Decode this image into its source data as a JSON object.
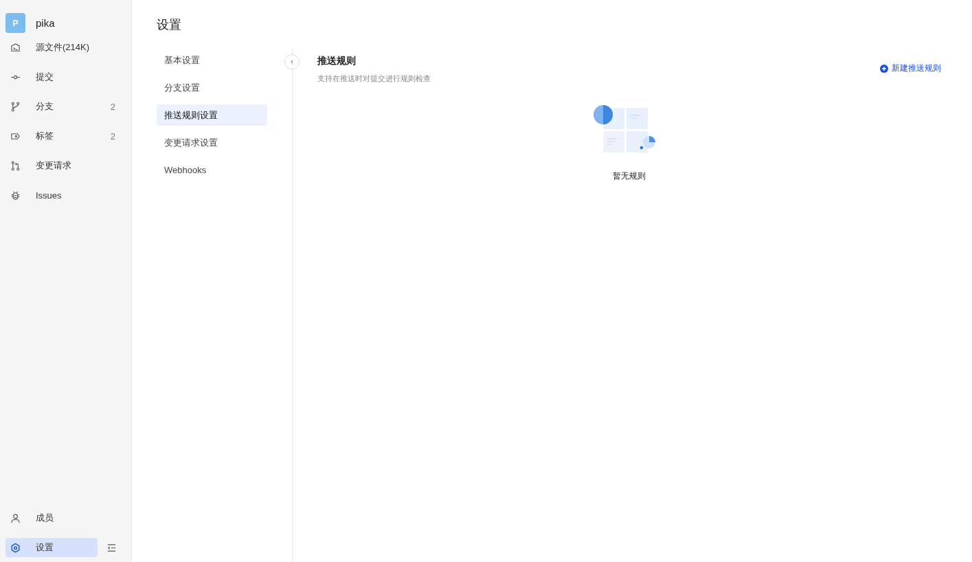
{
  "sidebar": {
    "avatar": "P",
    "repo": "pika",
    "items": [
      {
        "label": "源文件(214K)",
        "selected": false
      },
      {
        "label": "提交",
        "selected": false
      },
      {
        "label": "分支",
        "count": "2",
        "selected": false
      },
      {
        "label": "标签",
        "count": "2",
        "selected": false
      },
      {
        "label": "变更请求",
        "selected": false
      },
      {
        "label": "Issues",
        "selected": false
      }
    ],
    "bottom_items": [
      {
        "label": "成员",
        "selected": false
      },
      {
        "label": "设置",
        "selected": true
      }
    ]
  },
  "page": {
    "title": "设置"
  },
  "settings_nav": [
    {
      "label": "基本设置",
      "selected": false
    },
    {
      "label": "分支设置",
      "selected": false
    },
    {
      "label": "推送规则设置",
      "selected": true
    },
    {
      "label": "变更请求设置",
      "selected": false
    },
    {
      "label": "Webhooks",
      "selected": false
    }
  ],
  "content": {
    "title": "推送规则",
    "description": "支持在推送时对提交进行规则检查",
    "new_button": "新建推送规则",
    "empty_text": "暂无规则"
  }
}
